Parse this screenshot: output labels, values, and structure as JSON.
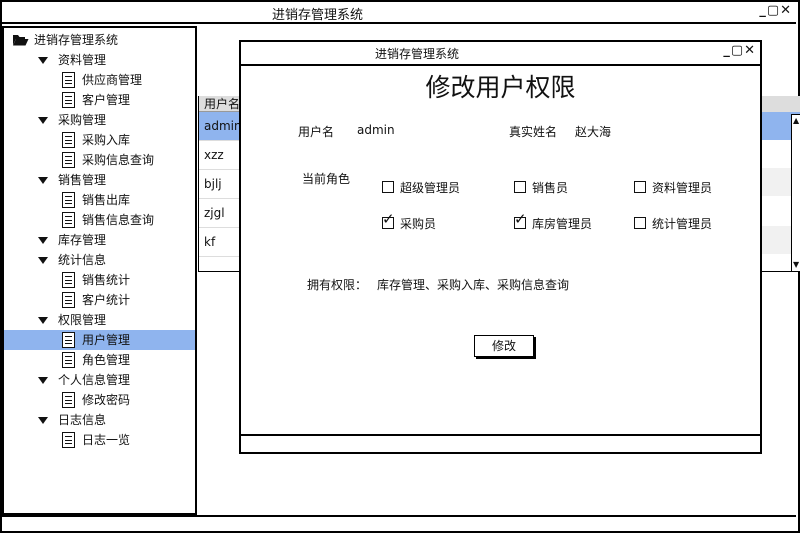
{
  "window": {
    "title": "进销存管理系统",
    "controls": "_▢✕"
  },
  "sidebar": {
    "root": "进销存管理系统",
    "groups": [
      {
        "label": "资料管理",
        "items": [
          "供应商管理",
          "客户管理"
        ]
      },
      {
        "label": "采购管理",
        "items": [
          "采购入库",
          "采购信息查询"
        ]
      },
      {
        "label": "销售管理",
        "items": [
          "销售出库",
          "销售信息查询"
        ]
      },
      {
        "label": "库存管理",
        "items": []
      },
      {
        "label": "统计信息",
        "items": [
          "销售统计",
          "客户统计"
        ]
      },
      {
        "label": "权限管理",
        "items": [
          "用户管理",
          "角色管理"
        ]
      },
      {
        "label": "个人信息管理",
        "items": [
          "修改密码"
        ]
      },
      {
        "label": "日志信息",
        "items": [
          "日志一览"
        ]
      }
    ],
    "selected": "用户管理"
  },
  "table": {
    "header": "用户名",
    "rows": [
      "admin",
      "xzz",
      "bjlj",
      "zjgl",
      "kf"
    ],
    "selected_row": "admin"
  },
  "dialog": {
    "title": "进销存管理系统",
    "controls": "_▢✕",
    "heading": "修改用户权限",
    "username_label": "用户名",
    "username_value": "admin",
    "realname_label": "真实姓名",
    "realname_value": "赵大海",
    "role_label": "当前角色",
    "roles": [
      {
        "label": "超级管理员",
        "checked": false
      },
      {
        "label": "销售员",
        "checked": false
      },
      {
        "label": "资料管理员",
        "checked": false
      },
      {
        "label": "采购员",
        "checked": true
      },
      {
        "label": "库房管理员",
        "checked": true
      },
      {
        "label": "统计管理员",
        "checked": false
      }
    ],
    "perm_label": "拥有权限：",
    "perm_value": "库存管理、采购入库、采购信息查询",
    "submit_label": "修改",
    "check_mark": "✓"
  },
  "colors": {
    "selection": "#8fb4ee",
    "header": "#dddddd",
    "border": "#000000"
  }
}
